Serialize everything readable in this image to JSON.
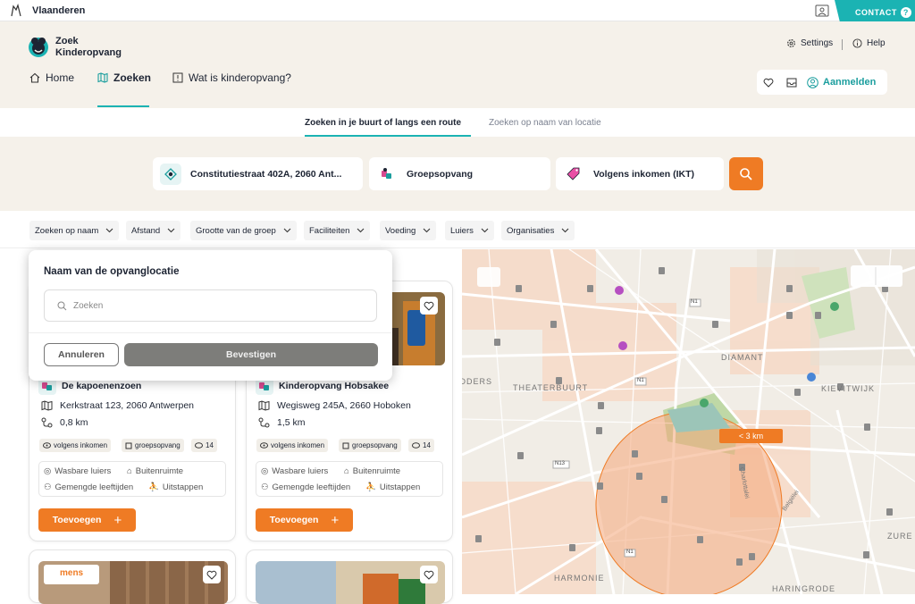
{
  "topbar": {
    "brand": "Vlaanderen",
    "contact": "CONTACT",
    "contact_q": "?"
  },
  "header": {
    "logo_line1": "Zoek",
    "logo_line2": "Kinderopvang",
    "settings": "Settings",
    "help": "Help",
    "nav": [
      {
        "label": "Home"
      },
      {
        "label": "Zoeken"
      },
      {
        "label": "Wat is kinderopvang?"
      }
    ],
    "login": "Aanmelden"
  },
  "tabs": {
    "route": "Zoeken in je buurt of langs een route",
    "name": "Zoeken op naam van locatie"
  },
  "search": {
    "address": "Constitutiestraat 402A, 2060 Ant...",
    "type": "Groepsopvang",
    "price": "Volgens inkomen (IKT)"
  },
  "filters": [
    "Zoeken op naam",
    "Afstand",
    "Grootte van de groep",
    "Faciliteiten",
    "Voeding",
    "Luiers",
    "Organisaties"
  ],
  "popup": {
    "title": "Naam van de opvanglocatie",
    "placeholder": "Zoeken",
    "cancel": "Annuleren",
    "confirm": "Bevestigen"
  },
  "cards": [
    {
      "name": "De kapoenenzoen",
      "address": "Kerkstraat 123, 2060 Antwerpen",
      "distance": "0,8 km",
      "badges": [
        "volgens inkomen",
        "groepsopvang",
        "14"
      ],
      "features": [
        "Wasbare luiers",
        "Buitenruimte",
        "Gemengde leeftijden",
        "Uitstappen"
      ],
      "add": "Toevoegen"
    },
    {
      "name": "Kinderopvang Hobsakee",
      "address": "Wegisweg 245A, 2660 Hoboken",
      "distance": "1,5 km",
      "badges": [
        "volgens inkomen",
        "groepsopvang",
        "14"
      ],
      "features": [
        "Wasbare luiers",
        "Buitenruimte",
        "Gemengde leeftijden",
        "Uitstappen"
      ],
      "add": "Toevoegen"
    }
  ],
  "card3_logo": "mens",
  "map": {
    "labels": [
      "DIAMANT",
      "THEATERBUURT",
      "KIEVITWIJK",
      "HARMONIE",
      "HARINGRODE",
      "ZURE",
      "RIDDERS"
    ],
    "radius": "< 3 km",
    "roads": [
      "N1",
      "N1",
      "N13",
      "N1"
    ],
    "street1": "Charlottalei",
    "street2": "Belgiëlei"
  },
  "colors": {
    "accent": "#1bb3b3",
    "orange": "#ef7b24"
  }
}
